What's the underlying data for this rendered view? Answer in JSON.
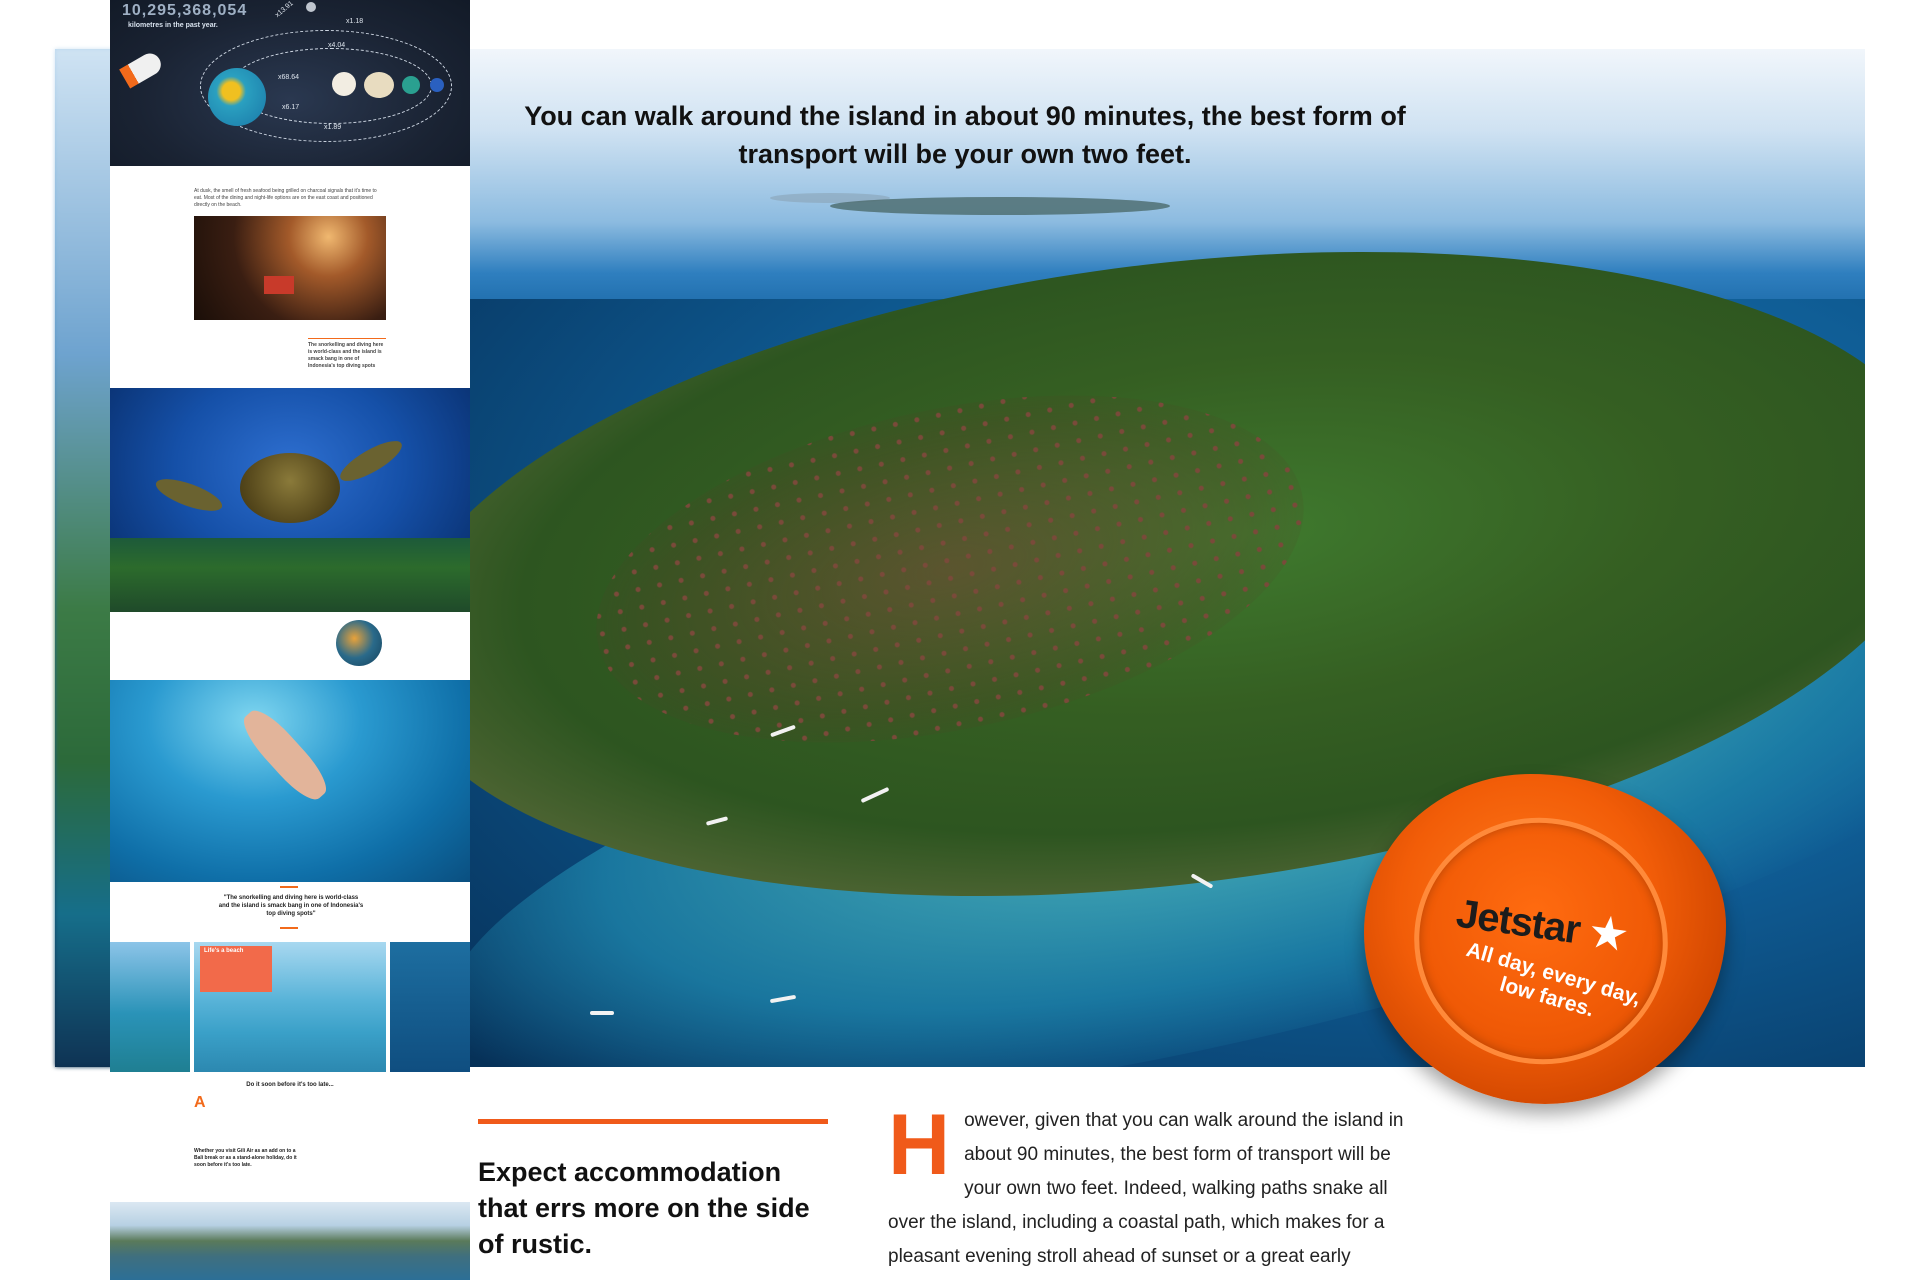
{
  "hero": {
    "caption": "You can walk around the island in about 90 minutes, the best form of transport will be your own two feet."
  },
  "badge": {
    "brand": "Jetstar",
    "star": "★",
    "tagline": "All day, every day, low fares.",
    "brand_color": "#f05a06"
  },
  "thumbnails": {
    "space_number": "10,295,368,054",
    "space_caption": "kilometres in the past year.",
    "multipliers": [
      "x1.18",
      "x4.04",
      "x68.64",
      "x6.17",
      "x1.89",
      "x13.91"
    ],
    "article1_text": "At dusk, the smell of fresh seafood being grilled on charcoal signals that it's time to eat. Most of the dining and night-life options are on the east coast and positioned directly on the beach.",
    "article1_pull": "The snorkelling and diving here is world-class and the island is smack bang in one of Indonesia's top diving spots",
    "quote": "\"The snorkelling and diving here is world-class and the island is smack bang in one of Indonesia's top diving spots\"",
    "card_title": "Life's a beach",
    "do_it_soon": "Do it soon before it's too late...",
    "drop_letter": "A",
    "bold_question": "Whether you visit Gili Air as an add on to a Bali break or as a stand-alone holiday, do it soon before it's too late."
  },
  "article": {
    "pull_quote": "Expect accommodation that errs more on the side of rustic.",
    "drop_cap": "H",
    "body": "owever, given that you can walk around the island in about 90 minutes, the best form of transport will be your own two feet. Indeed, walking paths snake all over the island, including a coastal path, which makes for a pleasant evening stroll ahead of sunset or a great early",
    "accent_color": "#f05a1a"
  }
}
